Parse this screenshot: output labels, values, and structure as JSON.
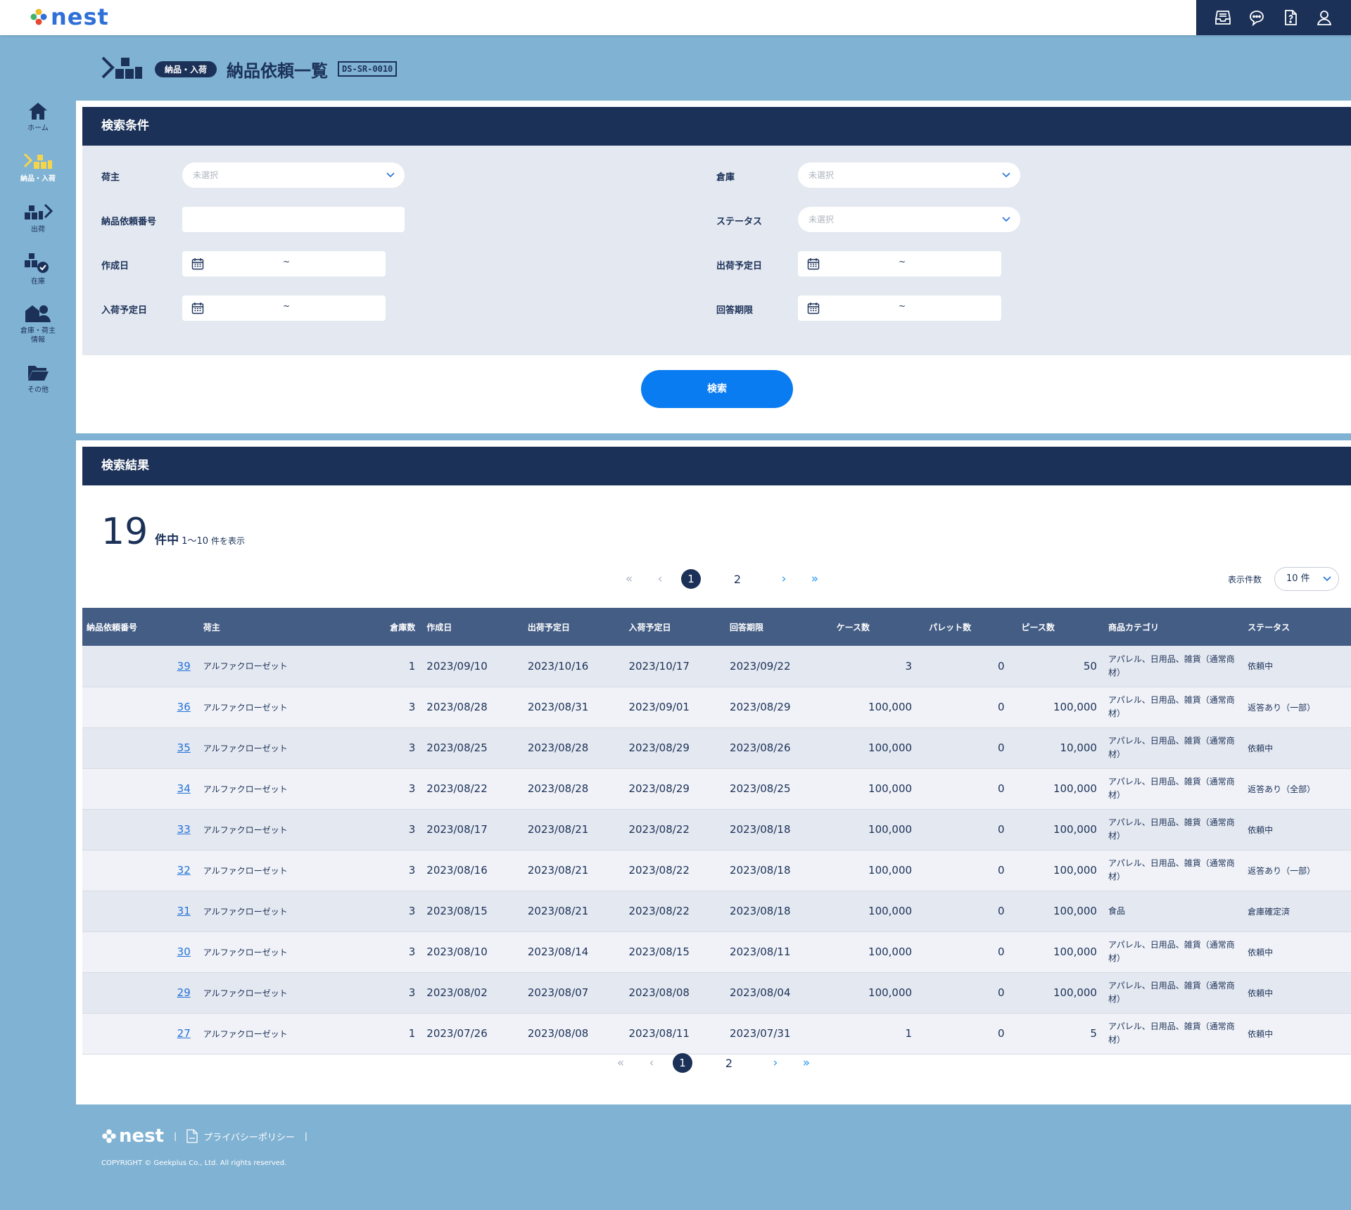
{
  "app": {
    "logo_text": "nest"
  },
  "topbar": {
    "icons": [
      "inbox-icon",
      "chat-bubble-icon",
      "help-document-icon",
      "user-icon"
    ]
  },
  "sidenav": {
    "items": [
      {
        "label": "ホーム",
        "icon": "home-icon",
        "active": false
      },
      {
        "label": "納品・入荷",
        "icon": "inbound-boxes-icon",
        "active": true
      },
      {
        "label": "出荷",
        "icon": "outbound-boxes-icon",
        "active": false
      },
      {
        "label": "在庫",
        "icon": "inventory-check-icon",
        "active": false
      },
      {
        "label": "倉庫・荷主\n情報",
        "icon": "warehouse-owner-icon",
        "active": false
      },
      {
        "label": "その他",
        "icon": "folder-icon",
        "active": false
      }
    ]
  },
  "page": {
    "category_badge": "納品・入荷",
    "title": "納品依頼一覧",
    "screen_id": "DS-SR-0010"
  },
  "search": {
    "header": "検索条件",
    "fields": {
      "owner_label": "荷主",
      "owner_placeholder": "未選択",
      "warehouse_label": "倉庫",
      "warehouse_placeholder": "未選択",
      "request_no_label": "納品依頼番号",
      "request_no_value": "",
      "status_label": "ステータス",
      "status_placeholder": "未選択",
      "created_label": "作成日",
      "ship_date_label": "出荷予定日",
      "arrival_date_label": "入荷予定日",
      "answer_deadline_label": "回答期限",
      "range_separator": "~"
    },
    "button_label": "検索"
  },
  "results": {
    "header": "検索結果",
    "total": "19",
    "total_unit": "件中",
    "range_text": "1～10",
    "range_suffix": "件を表示",
    "per_page_label": "表示件数",
    "per_page_value": "10 件",
    "pagination": {
      "first": "«",
      "prev": "‹",
      "pages": [
        "1",
        "2"
      ],
      "current": "1",
      "next": "›",
      "last": "»"
    },
    "columns": [
      "納品依頼番号",
      "荷主",
      "倉庫数",
      "作成日",
      "出荷予定日",
      "入荷予定日",
      "回答期限",
      "ケース数",
      "パレット数",
      "ピース数",
      "商品カテゴリ",
      "ステータス"
    ],
    "rows": [
      {
        "id": "39",
        "owner": "アルファクローゼット",
        "warehouses": "1",
        "created": "2023/09/10",
        "ship": "2023/10/16",
        "arrival": "2023/10/17",
        "deadline": "2023/09/22",
        "cases": "3",
        "pallets": "0",
        "pieces": "50",
        "category": "アパレル、日用品、雑貨（通常商材）",
        "status": "依頼中"
      },
      {
        "id": "36",
        "owner": "アルファクローゼット",
        "warehouses": "3",
        "created": "2023/08/28",
        "ship": "2023/08/31",
        "arrival": "2023/09/01",
        "deadline": "2023/08/29",
        "cases": "100,000",
        "pallets": "0",
        "pieces": "100,000",
        "category": "アパレル、日用品、雑貨（通常商材）",
        "status": "返答あり（一部）"
      },
      {
        "id": "35",
        "owner": "アルファクローゼット",
        "warehouses": "3",
        "created": "2023/08/25",
        "ship": "2023/08/28",
        "arrival": "2023/08/29",
        "deadline": "2023/08/26",
        "cases": "100,000",
        "pallets": "0",
        "pieces": "10,000",
        "category": "アパレル、日用品、雑貨（通常商材）",
        "status": "依頼中"
      },
      {
        "id": "34",
        "owner": "アルファクローゼット",
        "warehouses": "3",
        "created": "2023/08/22",
        "ship": "2023/08/28",
        "arrival": "2023/08/29",
        "deadline": "2023/08/25",
        "cases": "100,000",
        "pallets": "0",
        "pieces": "100,000",
        "category": "アパレル、日用品、雑貨（通常商材）",
        "status": "返答あり（全部）"
      },
      {
        "id": "33",
        "owner": "アルファクローゼット",
        "warehouses": "3",
        "created": "2023/08/17",
        "ship": "2023/08/21",
        "arrival": "2023/08/22",
        "deadline": "2023/08/18",
        "cases": "100,000",
        "pallets": "0",
        "pieces": "100,000",
        "category": "アパレル、日用品、雑貨（通常商材）",
        "status": "依頼中"
      },
      {
        "id": "32",
        "owner": "アルファクローゼット",
        "warehouses": "3",
        "created": "2023/08/16",
        "ship": "2023/08/21",
        "arrival": "2023/08/22",
        "deadline": "2023/08/18",
        "cases": "100,000",
        "pallets": "0",
        "pieces": "100,000",
        "category": "アパレル、日用品、雑貨（通常商材）",
        "status": "返答あり（一部）"
      },
      {
        "id": "31",
        "owner": "アルファクローゼット",
        "warehouses": "3",
        "created": "2023/08/15",
        "ship": "2023/08/21",
        "arrival": "2023/08/22",
        "deadline": "2023/08/18",
        "cases": "100,000",
        "pallets": "0",
        "pieces": "100,000",
        "category": "食品",
        "status": "倉庫確定済"
      },
      {
        "id": "30",
        "owner": "アルファクローゼット",
        "warehouses": "3",
        "created": "2023/08/10",
        "ship": "2023/08/14",
        "arrival": "2023/08/15",
        "deadline": "2023/08/11",
        "cases": "100,000",
        "pallets": "0",
        "pieces": "100,000",
        "category": "アパレル、日用品、雑貨（通常商材）",
        "status": "依頼中"
      },
      {
        "id": "29",
        "owner": "アルファクローゼット",
        "warehouses": "3",
        "created": "2023/08/02",
        "ship": "2023/08/07",
        "arrival": "2023/08/08",
        "deadline": "2023/08/04",
        "cases": "100,000",
        "pallets": "0",
        "pieces": "100,000",
        "category": "アパレル、日用品、雑貨（通常商材）",
        "status": "依頼中"
      },
      {
        "id": "27",
        "owner": "アルファクローゼット",
        "warehouses": "1",
        "created": "2023/07/26",
        "ship": "2023/08/08",
        "arrival": "2023/08/11",
        "deadline": "2023/07/31",
        "cases": "1",
        "pallets": "0",
        "pieces": "5",
        "category": "アパレル、日用品、雑貨（通常商材）",
        "status": "依頼中"
      }
    ]
  },
  "footer": {
    "logo_text": "nest",
    "privacy_link": "プライバシーポリシー",
    "pdf_icon": "pdf-document-icon",
    "separator": "|",
    "copyright": "COPYRIGHT © Geekplus Co., Ltd. All rights reserved."
  },
  "colors": {
    "navy": "#1b3158",
    "background": "#80b2d3",
    "accent_blue": "#0a7cf2",
    "active_nav": "#f5d64a",
    "link": "#2272d9"
  }
}
